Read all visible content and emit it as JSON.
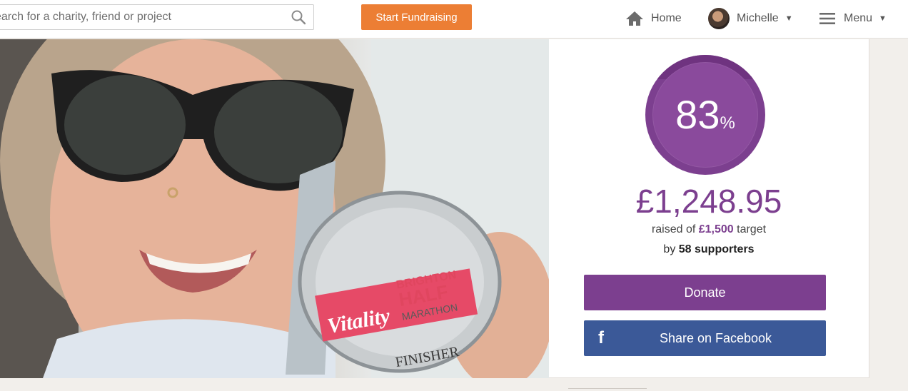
{
  "header": {
    "search_placeholder": "earch for a charity, friend or project",
    "start_fundraising_label": "Start Fundraising",
    "nav": {
      "home_label": "Home",
      "user_label": "Michelle",
      "menu_label": "Menu"
    }
  },
  "hero": {
    "photo_description_icon": "runner-selfie-with-medal",
    "medal_text": {
      "brand": "Vitality",
      "event_line1": "BRIGHTON",
      "event_line2": "HALF",
      "event_line3": "MARATHON",
      "finisher": "FINISHER"
    }
  },
  "fundraising": {
    "percent_value": "83",
    "percent_symbol": "%",
    "progress": 0.83,
    "amount_raised": "£1,248.95",
    "target_prefix": "raised of ",
    "target_amount": "£1,500",
    "target_suffix": " target",
    "supporters_prefix": "by ",
    "supporters_count": "58 supporters",
    "donate_label": "Donate",
    "facebook_icon_glyph": "f",
    "facebook_label": "Share on Facebook"
  },
  "colors": {
    "accent_purple": "#7c3f8f",
    "cta_orange": "#ec7e34",
    "facebook_blue": "#3b5998"
  }
}
